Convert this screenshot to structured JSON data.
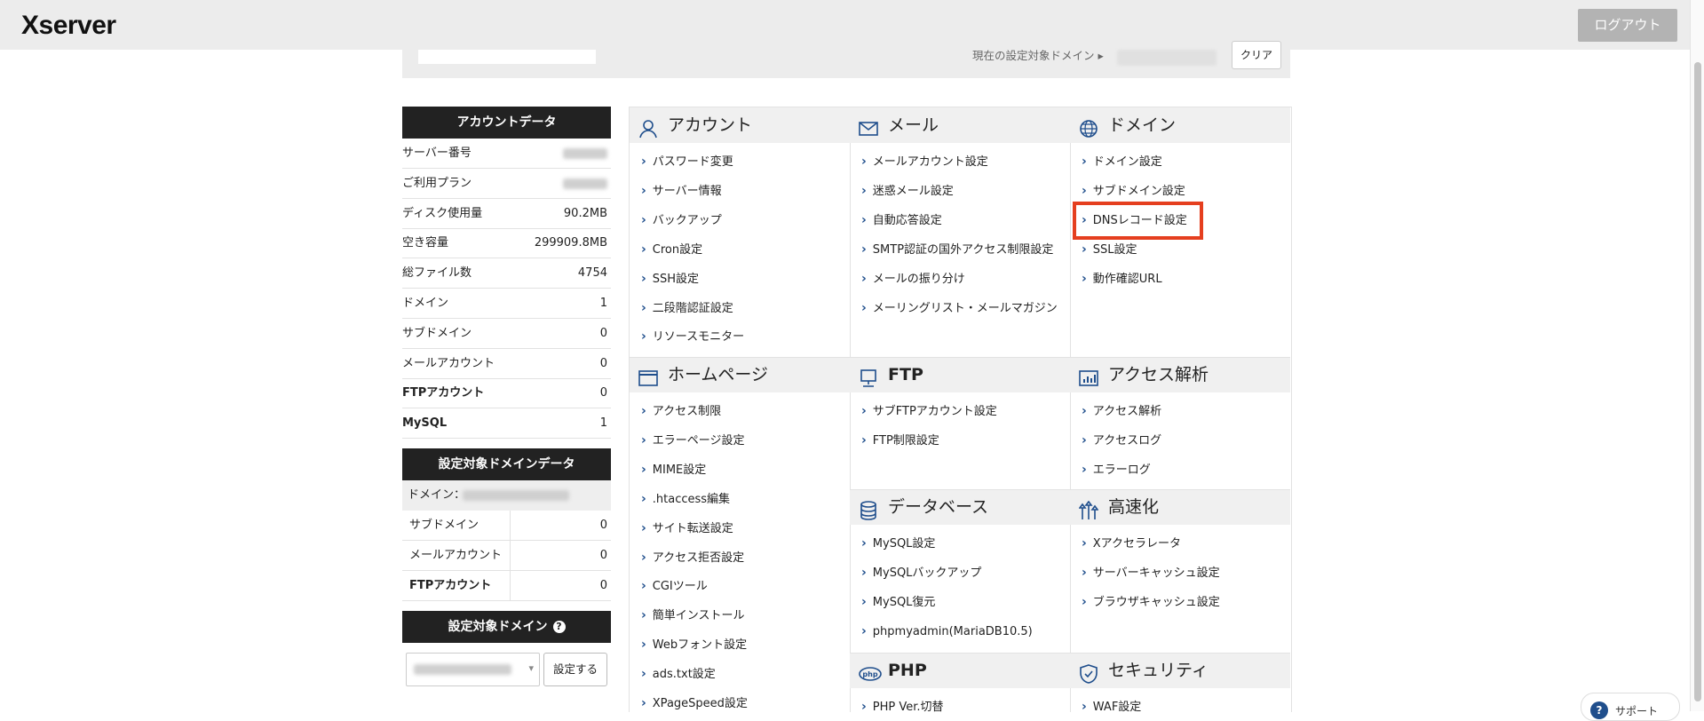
{
  "header": {
    "logo": "Xserver",
    "logout_label": "ログアウト"
  },
  "topbar": {
    "current_domain_label": "現在の設定対象ドメイン ▸",
    "clear_label": "クリア"
  },
  "account_data": {
    "title": "アカウントデータ",
    "rows": [
      {
        "label": "サーバー番号",
        "value": ""
      },
      {
        "label": "ご利用プラン",
        "value": ""
      },
      {
        "label": "ディスク使用量",
        "value": "90.2MB"
      },
      {
        "label": "空き容量",
        "value": "299909.8MB"
      },
      {
        "label": "総ファイル数",
        "value": "4754"
      },
      {
        "label": "ドメイン",
        "value": "1"
      },
      {
        "label": "サブドメイン",
        "value": "0"
      },
      {
        "label": "メールアカウント",
        "value": "0"
      },
      {
        "label": "FTPアカウント",
        "value": "0"
      },
      {
        "label": "MySQL",
        "value": "1"
      }
    ]
  },
  "domain_data": {
    "title": "設定対象ドメインデータ",
    "domain_label": "ドメイン：",
    "rows": [
      {
        "label": "サブドメイン",
        "value": "0"
      },
      {
        "label": "メールアカウント",
        "value": "0"
      },
      {
        "label": "FTPアカウント",
        "value": "0"
      }
    ]
  },
  "target_domain": {
    "title": "設定対象ドメイン",
    "help": "?",
    "set_label": "設定する"
  },
  "sections": {
    "account": {
      "title": "アカウント",
      "items": [
        "パスワード変更",
        "サーバー情報",
        "バックアップ",
        "Cron設定",
        "SSH設定",
        "二段階認証設定",
        "リソースモニター"
      ]
    },
    "mail": {
      "title": "メール",
      "items": [
        "メールアカウント設定",
        "迷惑メール設定",
        "自動応答設定",
        "SMTP認証の国外アクセス制限設定",
        "メールの振り分け",
        "メーリングリスト・メールマガジン"
      ]
    },
    "domain": {
      "title": "ドメイン",
      "items": [
        "ドメイン設定",
        "サブドメイン設定",
        "DNSレコード設定",
        "SSL設定",
        "動作確認URL"
      ]
    },
    "homepage": {
      "title": "ホームページ",
      "items": [
        "アクセス制限",
        "エラーページ設定",
        "MIME設定",
        ".htaccess編集",
        "サイト転送設定",
        "アクセス拒否設定",
        "CGIツール",
        "簡単インストール",
        "Webフォント設定",
        "ads.txt設定",
        "XPageSpeed設定"
      ]
    },
    "ftp": {
      "title": "FTP",
      "items": [
        "サブFTPアカウント設定",
        "FTP制限設定"
      ]
    },
    "analytics": {
      "title": "アクセス解析",
      "items": [
        "アクセス解析",
        "アクセスログ",
        "エラーログ"
      ]
    },
    "database": {
      "title": "データベース",
      "items": [
        "MySQL設定",
        "MySQLバックアップ",
        "MySQL復元",
        "phpmyadmin(MariaDB10.5)"
      ]
    },
    "speed": {
      "title": "高速化",
      "items": [
        "Xアクセラレータ",
        "サーバーキャッシュ設定",
        "ブラウザキャッシュ設定"
      ]
    },
    "php": {
      "title": "PHP",
      "items": [
        "PHP Ver.切替"
      ]
    },
    "security": {
      "title": "セキュリティ",
      "items": [
        "WAF設定"
      ]
    }
  },
  "support": {
    "icon": "?",
    "label": "サポート"
  }
}
